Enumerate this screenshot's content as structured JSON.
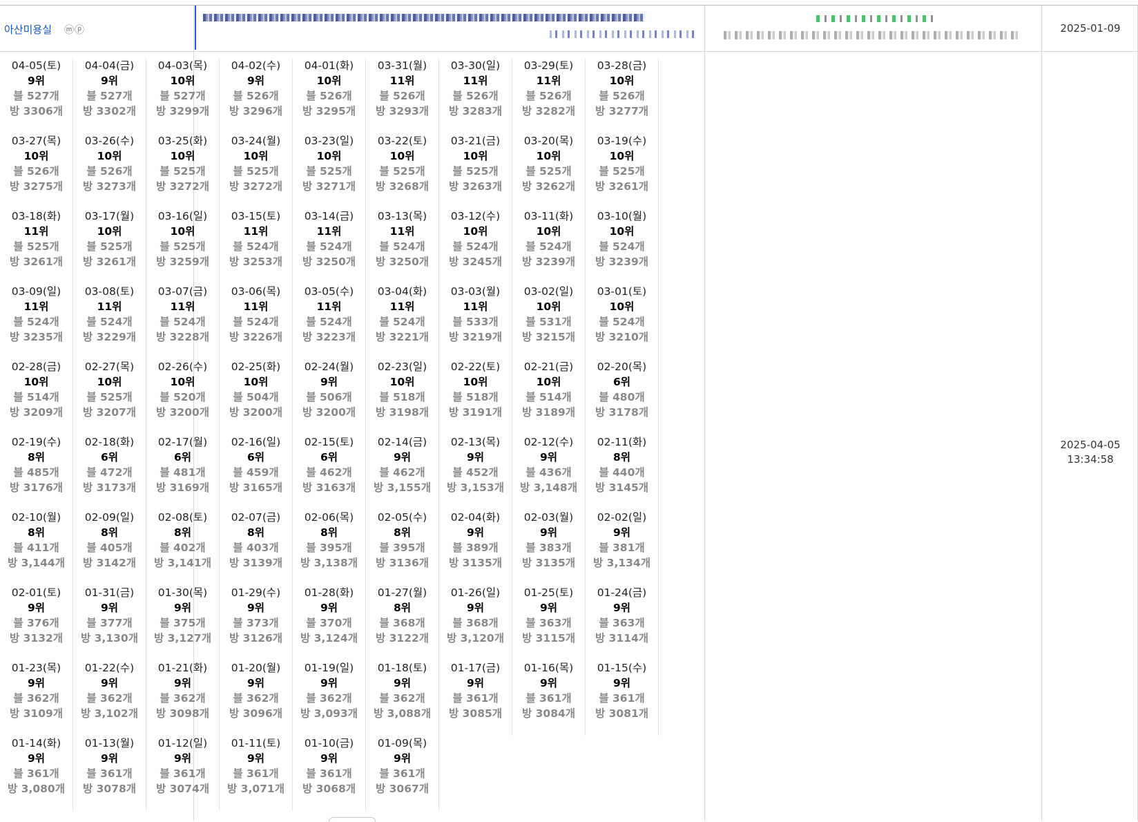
{
  "shop": {
    "name": "아산미용실",
    "icons": "ⓜⓟ"
  },
  "registered_date": "2025-01-09",
  "updated": {
    "date": "2025-04-05",
    "time": "13:34:58"
  },
  "rank_prefix": {
    "blog": "블",
    "visitor": "방"
  },
  "rows": [
    [
      {
        "d": "04-05(토)",
        "r": "9위",
        "b": "블 527개",
        "p": "방 3306개"
      },
      {
        "d": "04-04(금)",
        "r": "9위",
        "b": "블 527개",
        "p": "방 3302개"
      },
      {
        "d": "04-03(목)",
        "r": "10위",
        "b": "블 527개",
        "p": "방 3299개"
      },
      {
        "d": "04-02(수)",
        "r": "9위",
        "b": "블 526개",
        "p": "방 3296개"
      },
      {
        "d": "04-01(화)",
        "r": "10위",
        "b": "블 526개",
        "p": "방 3295개"
      },
      {
        "d": "03-31(월)",
        "r": "11위",
        "b": "블 526개",
        "p": "방 3293개"
      },
      {
        "d": "03-30(일)",
        "r": "11위",
        "b": "블 526개",
        "p": "방 3283개"
      },
      {
        "d": "03-29(토)",
        "r": "11위",
        "b": "블 526개",
        "p": "방 3282개"
      },
      {
        "d": "03-28(금)",
        "r": "10위",
        "b": "블 526개",
        "p": "방 3277개"
      }
    ],
    [
      {
        "d": "03-27(목)",
        "r": "10위",
        "b": "블 526개",
        "p": "방 3275개"
      },
      {
        "d": "03-26(수)",
        "r": "10위",
        "b": "블 526개",
        "p": "방 3273개"
      },
      {
        "d": "03-25(화)",
        "r": "10위",
        "b": "블 525개",
        "p": "방 3272개"
      },
      {
        "d": "03-24(월)",
        "r": "10위",
        "b": "블 525개",
        "p": "방 3272개"
      },
      {
        "d": "03-23(일)",
        "r": "10위",
        "b": "블 525개",
        "p": "방 3271개"
      },
      {
        "d": "03-22(토)",
        "r": "10위",
        "b": "블 525개",
        "p": "방 3268개"
      },
      {
        "d": "03-21(금)",
        "r": "10위",
        "b": "블 525개",
        "p": "방 3263개"
      },
      {
        "d": "03-20(목)",
        "r": "10위",
        "b": "블 525개",
        "p": "방 3262개"
      },
      {
        "d": "03-19(수)",
        "r": "10위",
        "b": "블 525개",
        "p": "방 3261개"
      }
    ],
    [
      {
        "d": "03-18(화)",
        "r": "11위",
        "b": "블 525개",
        "p": "방 3261개"
      },
      {
        "d": "03-17(월)",
        "r": "10위",
        "b": "블 525개",
        "p": "방 3261개"
      },
      {
        "d": "03-16(일)",
        "r": "10위",
        "b": "블 525개",
        "p": "방 3259개"
      },
      {
        "d": "03-15(토)",
        "r": "11위",
        "b": "블 524개",
        "p": "방 3253개"
      },
      {
        "d": "03-14(금)",
        "r": "11위",
        "b": "블 524개",
        "p": "방 3250개"
      },
      {
        "d": "03-13(목)",
        "r": "11위",
        "b": "블 524개",
        "p": "방 3250개"
      },
      {
        "d": "03-12(수)",
        "r": "10위",
        "b": "블 524개",
        "p": "방 3245개"
      },
      {
        "d": "03-11(화)",
        "r": "10위",
        "b": "블 524개",
        "p": "방 3239개"
      },
      {
        "d": "03-10(월)",
        "r": "10위",
        "b": "블 524개",
        "p": "방 3239개"
      }
    ],
    [
      {
        "d": "03-09(일)",
        "r": "11위",
        "b": "블 524개",
        "p": "방 3235개"
      },
      {
        "d": "03-08(토)",
        "r": "11위",
        "b": "블 524개",
        "p": "방 3229개"
      },
      {
        "d": "03-07(금)",
        "r": "11위",
        "b": "블 524개",
        "p": "방 3228개"
      },
      {
        "d": "03-06(목)",
        "r": "11위",
        "b": "블 524개",
        "p": "방 3226개"
      },
      {
        "d": "03-05(수)",
        "r": "11위",
        "b": "블 524개",
        "p": "방 3223개"
      },
      {
        "d": "03-04(화)",
        "r": "11위",
        "b": "블 524개",
        "p": "방 3221개"
      },
      {
        "d": "03-03(월)",
        "r": "11위",
        "b": "블 533개",
        "p": "방 3219개"
      },
      {
        "d": "03-02(일)",
        "r": "10위",
        "b": "블 531개",
        "p": "방 3215개"
      },
      {
        "d": "03-01(토)",
        "r": "10위",
        "b": "블 524개",
        "p": "방 3210개"
      }
    ],
    [
      {
        "d": "02-28(금)",
        "r": "10위",
        "b": "블 514개",
        "p": "방 3209개"
      },
      {
        "d": "02-27(목)",
        "r": "10위",
        "b": "블 525개",
        "p": "방 3207개"
      },
      {
        "d": "02-26(수)",
        "r": "10위",
        "b": "블 520개",
        "p": "방 3200개"
      },
      {
        "d": "02-25(화)",
        "r": "10위",
        "b": "블 504개",
        "p": "방 3200개"
      },
      {
        "d": "02-24(월)",
        "r": "9위",
        "b": "블 506개",
        "p": "방 3200개"
      },
      {
        "d": "02-23(일)",
        "r": "10위",
        "b": "블 518개",
        "p": "방 3198개"
      },
      {
        "d": "02-22(토)",
        "r": "10위",
        "b": "블 518개",
        "p": "방 3191개"
      },
      {
        "d": "02-21(금)",
        "r": "10위",
        "b": "블 514개",
        "p": "방 3189개"
      },
      {
        "d": "02-20(목)",
        "r": "6위",
        "b": "블 480개",
        "p": "방 3178개"
      }
    ],
    [
      {
        "d": "02-19(수)",
        "r": "8위",
        "b": "블 485개",
        "p": "방 3176개"
      },
      {
        "d": "02-18(화)",
        "r": "6위",
        "b": "블 472개",
        "p": "방 3173개"
      },
      {
        "d": "02-17(월)",
        "r": "6위",
        "b": "블 481개",
        "p": "방 3169개"
      },
      {
        "d": "02-16(일)",
        "r": "6위",
        "b": "블 459개",
        "p": "방 3165개"
      },
      {
        "d": "02-15(토)",
        "r": "6위",
        "b": "블 462개",
        "p": "방 3163개"
      },
      {
        "d": "02-14(금)",
        "r": "9위",
        "b": "블 462개",
        "p": "방 3,155개"
      },
      {
        "d": "02-13(목)",
        "r": "9위",
        "b": "블 452개",
        "p": "방 3,153개"
      },
      {
        "d": "02-12(수)",
        "r": "9위",
        "b": "블 436개",
        "p": "방 3,148개"
      },
      {
        "d": "02-11(화)",
        "r": "8위",
        "b": "블 440개",
        "p": "방 3145개"
      }
    ],
    [
      {
        "d": "02-10(월)",
        "r": "8위",
        "b": "블 411개",
        "p": "방 3,144개"
      },
      {
        "d": "02-09(일)",
        "r": "8위",
        "b": "블 405개",
        "p": "방 3142개"
      },
      {
        "d": "02-08(토)",
        "r": "8위",
        "b": "블 402개",
        "p": "방 3,141개"
      },
      {
        "d": "02-07(금)",
        "r": "8위",
        "b": "블 403개",
        "p": "방 3139개"
      },
      {
        "d": "02-06(목)",
        "r": "8위",
        "b": "블 395개",
        "p": "방 3,138개"
      },
      {
        "d": "02-05(수)",
        "r": "8위",
        "b": "블 395개",
        "p": "방 3136개"
      },
      {
        "d": "02-04(화)",
        "r": "9위",
        "b": "블 389개",
        "p": "방 3135개"
      },
      {
        "d": "02-03(월)",
        "r": "9위",
        "b": "블 383개",
        "p": "방 3135개"
      },
      {
        "d": "02-02(일)",
        "r": "9위",
        "b": "블 381개",
        "p": "방 3,134개"
      }
    ],
    [
      {
        "d": "02-01(토)",
        "r": "9위",
        "b": "블 376개",
        "p": "방 3132개"
      },
      {
        "d": "01-31(금)",
        "r": "9위",
        "b": "블 377개",
        "p": "방 3,130개"
      },
      {
        "d": "01-30(목)",
        "r": "9위",
        "b": "블 375개",
        "p": "방 3,127개"
      },
      {
        "d": "01-29(수)",
        "r": "9위",
        "b": "블 373개",
        "p": "방 3126개"
      },
      {
        "d": "01-28(화)",
        "r": "9위",
        "b": "블 370개",
        "p": "방 3,124개"
      },
      {
        "d": "01-27(월)",
        "r": "8위",
        "b": "블 368개",
        "p": "방 3122개"
      },
      {
        "d": "01-26(일)",
        "r": "9위",
        "b": "블 368개",
        "p": "방 3,120개"
      },
      {
        "d": "01-25(토)",
        "r": "9위",
        "b": "블 363개",
        "p": "방 3115개"
      },
      {
        "d": "01-24(금)",
        "r": "9위",
        "b": "블 363개",
        "p": "방 3114개"
      }
    ],
    [
      {
        "d": "01-23(목)",
        "r": "9위",
        "b": "블 362개",
        "p": "방 3109개"
      },
      {
        "d": "01-22(수)",
        "r": "9위",
        "b": "블 362개",
        "p": "방 3,102개"
      },
      {
        "d": "01-21(화)",
        "r": "9위",
        "b": "블 362개",
        "p": "방 3098개"
      },
      {
        "d": "01-20(월)",
        "r": "9위",
        "b": "블 362개",
        "p": "방 3096개"
      },
      {
        "d": "01-19(일)",
        "r": "9위",
        "b": "블 362개",
        "p": "방 3,093개"
      },
      {
        "d": "01-18(토)",
        "r": "9위",
        "b": "블 362개",
        "p": "방 3,088개"
      },
      {
        "d": "01-17(금)",
        "r": "9위",
        "b": "블 361개",
        "p": "방 3085개"
      },
      {
        "d": "01-16(목)",
        "r": "9위",
        "b": "블 361개",
        "p": "방 3084개"
      },
      {
        "d": "01-15(수)",
        "r": "9위",
        "b": "블 361개",
        "p": "방 3081개"
      }
    ],
    [
      {
        "d": "01-14(화)",
        "r": "9위",
        "b": "블 361개",
        "p": "방 3,080개"
      },
      {
        "d": "01-13(월)",
        "r": "9위",
        "b": "블 361개",
        "p": "방 3078개"
      },
      {
        "d": "01-12(일)",
        "r": "9위",
        "b": "블 361개",
        "p": "방 3074개"
      },
      {
        "d": "01-11(토)",
        "r": "9위",
        "b": "블 361개",
        "p": "방 3,071개"
      },
      {
        "d": "01-10(금)",
        "r": "9위",
        "b": "블 361개",
        "p": "방 3068개"
      },
      {
        "d": "01-09(목)",
        "r": "9위",
        "b": "블 361개",
        "p": "방 3067개"
      }
    ]
  ]
}
